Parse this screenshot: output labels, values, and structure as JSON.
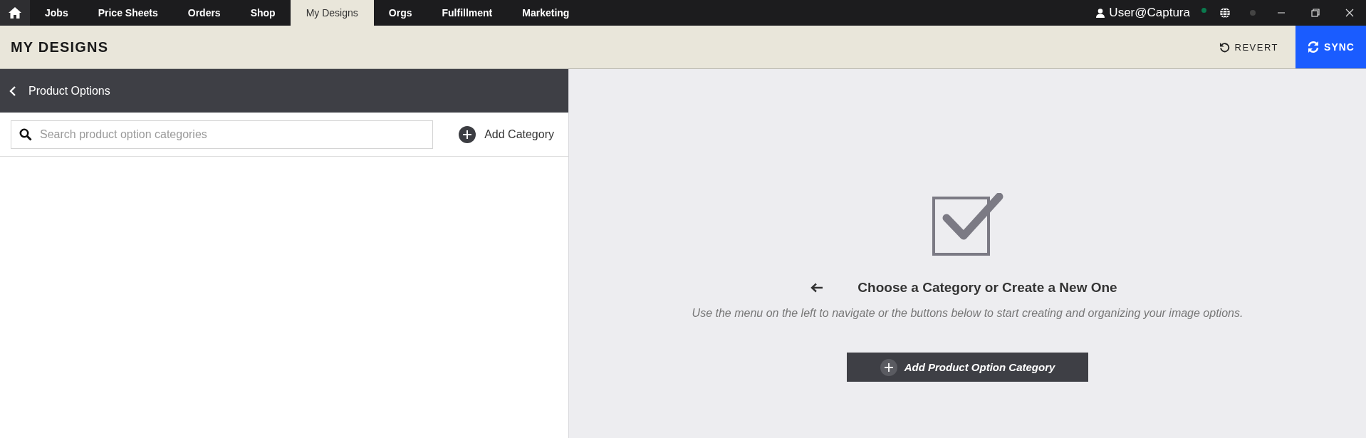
{
  "nav": {
    "items": [
      {
        "label": "Jobs",
        "selected": false
      },
      {
        "label": "Price Sheets",
        "selected": false
      },
      {
        "label": "Orders",
        "selected": false
      },
      {
        "label": "Shop",
        "selected": false
      },
      {
        "label": "My Designs",
        "selected": true
      },
      {
        "label": "Orgs",
        "selected": false
      },
      {
        "label": "Fulfillment",
        "selected": false
      },
      {
        "label": "Marketing",
        "selected": false
      }
    ],
    "user": "User@Captura",
    "online": true
  },
  "header": {
    "title": "MY DESIGNS",
    "revert": "REVERT",
    "sync": "SYNC"
  },
  "sidebar": {
    "title": "Product Options",
    "search": {
      "placeholder": "Search product option categories"
    },
    "add_button": "Add Category"
  },
  "empty_state": {
    "title": "Choose a Category or Create a New One",
    "description": "Use the menu on the left to navigate or the buttons below to start creating and organizing your image options.",
    "button": "Add Product Option Category"
  }
}
